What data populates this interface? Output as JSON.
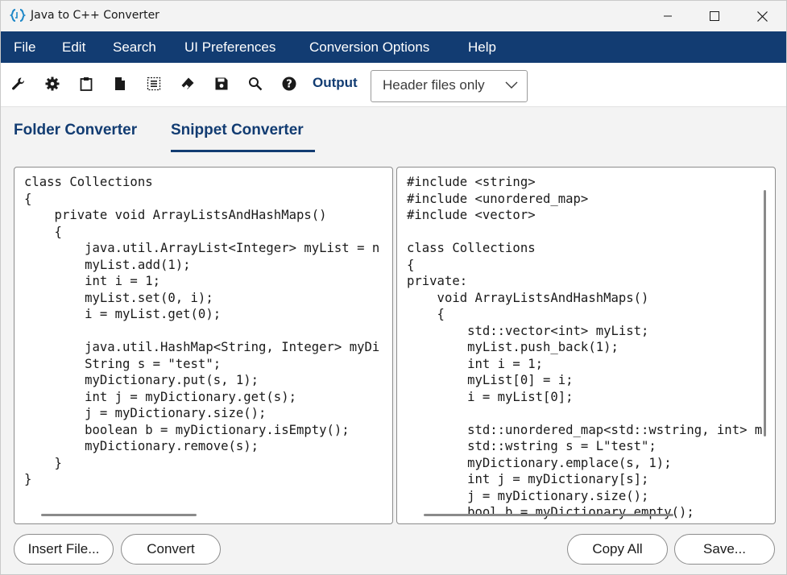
{
  "window": {
    "title": "Java to C++ Converter"
  },
  "menu": [
    "File",
    "Edit",
    "Search",
    "UI Preferences",
    "Conversion Options",
    "Help"
  ],
  "toolbar": {
    "icons": [
      "wrench-icon",
      "gear-icon",
      "clipboard-icon",
      "document-icon",
      "select-all-icon",
      "eraser-icon",
      "save-icon",
      "search-icon",
      "help-icon"
    ],
    "output_label": "Output",
    "output_selected": "Header files only"
  },
  "tabs": {
    "folder": "Folder Converter",
    "snippet": "Snippet Converter",
    "active": "Snippet Converter"
  },
  "java_code": "class Collections\n{\n    private void ArrayListsAndHashMaps()\n    {\n        java.util.ArrayList<Integer> myList = n\n        myList.add(1);\n        int i = 1;\n        myList.set(0, i);\n        i = myList.get(0);\n\n        java.util.HashMap<String, Integer> myDi\n        String s = \"test\";\n        myDictionary.put(s, 1);\n        int j = myDictionary.get(s);\n        j = myDictionary.size();\n        boolean b = myDictionary.isEmpty();\n        myDictionary.remove(s);\n    }\n}",
  "cpp_code": "#include <string>\n#include <unordered_map>\n#include <vector>\n\nclass Collections\n{\nprivate:\n    void ArrayListsAndHashMaps()\n    {\n        std::vector<int> myList;\n        myList.push_back(1);\n        int i = 1;\n        myList[0] = i;\n        i = myList[0];\n\n        std::unordered_map<std::wstring, int> m\n        std::wstring s = L\"test\";\n        myDictionary.emplace(s, 1);\n        int j = myDictionary[s];\n        j = myDictionary.size();\n        bool b = myDictionary.empty();",
  "buttons": {
    "insert_file": "Insert File...",
    "convert": "Convert",
    "copy_all": "Copy All",
    "save": "Save..."
  }
}
